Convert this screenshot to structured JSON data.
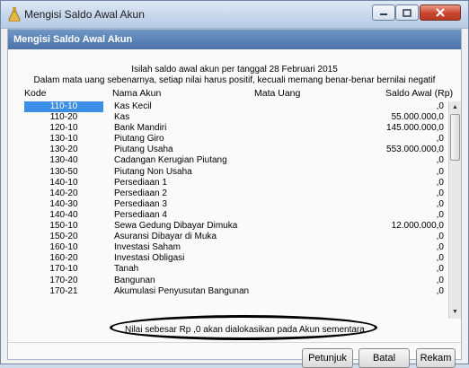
{
  "window": {
    "title": "Mengisi Saldo Awal Akun"
  },
  "panel": {
    "title": "Mengisi Saldo Awal Akun",
    "intro_line1": "Isilah saldo awal akun per tanggal 28 Februari 2015",
    "intro_line2": "Dalam mata uang sebenarnya, setiap nilai harus positif, kecuali memang benar-benar bernilai negatif"
  },
  "table": {
    "headers": {
      "code": "Kode",
      "name": "Nama Akun",
      "currency": "Mata Uang",
      "balance": "Saldo Awal (Rp)"
    },
    "rows": [
      {
        "code": "110-10",
        "name": "Kas Kecil",
        "balance": ",0",
        "selected": true
      },
      {
        "code": "110-20",
        "name": "Kas",
        "balance": "55.000.000,0"
      },
      {
        "code": "120-10",
        "name": "Bank Mandiri",
        "balance": "145.000.000,0"
      },
      {
        "code": "130-10",
        "name": "Piutang Giro",
        "balance": ",0"
      },
      {
        "code": "130-20",
        "name": "Piutang Usaha",
        "balance": "553.000.000,0"
      },
      {
        "code": "130-40",
        "name": "Cadangan Kerugian Piutang",
        "balance": ",0"
      },
      {
        "code": "130-50",
        "name": "Piutang Non Usaha",
        "balance": ",0"
      },
      {
        "code": "140-10",
        "name": "Persediaan 1",
        "balance": ",0"
      },
      {
        "code": "140-20",
        "name": "Persediaan 2",
        "balance": ",0"
      },
      {
        "code": "140-30",
        "name": "Persediaan 3",
        "balance": ",0"
      },
      {
        "code": "140-40",
        "name": "Persediaan 4",
        "balance": ",0"
      },
      {
        "code": "150-10",
        "name": "Sewa Gedung Dibayar Dimuka",
        "balance": "12.000.000,0"
      },
      {
        "code": "150-20",
        "name": "Asuransi Dibayar di Muka",
        "balance": ",0"
      },
      {
        "code": "160-10",
        "name": "Investasi Saham",
        "balance": ",0"
      },
      {
        "code": "160-20",
        "name": "Investasi Obligasi",
        "balance": ",0"
      },
      {
        "code": "170-10",
        "name": "Tanah",
        "balance": ",0"
      },
      {
        "code": "170-20",
        "name": "Bangunan",
        "balance": ",0"
      },
      {
        "code": "170-21",
        "name": "Akumulasi Penyusutan Bangunan",
        "balance": ",0"
      }
    ]
  },
  "note": "Nilai sebesar Rp ,0 akan dialokasikan pada Akun sementara",
  "buttons": {
    "help": "Petunjuk",
    "cancel": "Batal",
    "save": "Rekam"
  },
  "colors": {
    "selection": "#3b8ee6",
    "panel_header": "#5a80b5"
  },
  "icons": {
    "app": "flask-icon"
  }
}
